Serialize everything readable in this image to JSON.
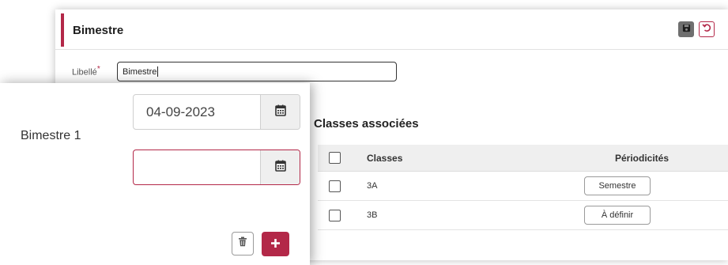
{
  "colors": {
    "accent": "#b32848",
    "save_bg": "#6f6f6f"
  },
  "form": {
    "title": "Bimestre",
    "label_libelle": "Libellé",
    "required_mark": "*",
    "libelle_value": "Bimestre"
  },
  "classes_section": {
    "title": "Classes associées",
    "columns": [
      "Classes",
      "Périodicités"
    ],
    "rows": [
      {
        "classe": "3A",
        "periodicite": "Semestre"
      },
      {
        "classe": "3B",
        "periodicite": "À définir"
      }
    ]
  },
  "period": {
    "name": "Bimestre 1",
    "start_date": "04-09-2023",
    "end_date": ""
  },
  "icons": {
    "save": "save-icon",
    "undo": "undo-icon",
    "calendar": "calendar-icon",
    "trash": "trash-icon",
    "add": "plus-icon"
  }
}
